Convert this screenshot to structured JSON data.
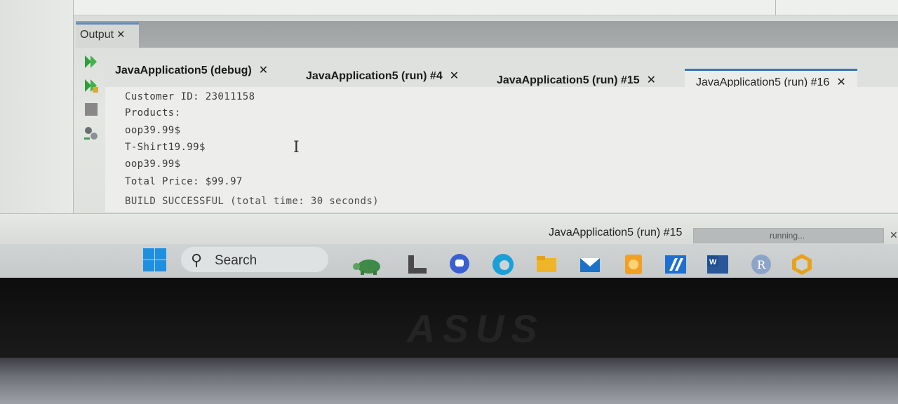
{
  "output_panel": {
    "title": "Output",
    "close_glyph": "✕"
  },
  "run_tabs": [
    {
      "label": "JavaApplication5 (debug)",
      "close": "✕"
    },
    {
      "label": "JavaApplication5 (run) #4",
      "close": "✕"
    },
    {
      "label": "JavaApplication5 (run) #15",
      "close": "✕"
    },
    {
      "label": "JavaApplication5 (run) #16",
      "close": "✕"
    }
  ],
  "console": {
    "lines": [
      "Customer ID: 23011158",
      "Products:",
      "oop39.99$",
      "T-Shirt19.99$",
      "oop39.99$",
      "Total Price: $99.97",
      "BUILD SUCCESSFUL (total time: 30 seconds)"
    ]
  },
  "status_bar": {
    "task_label": "JavaApplication5 (run) #15",
    "progress_text": "running...",
    "close_glyph": "✕"
  },
  "taskbar": {
    "search_label": "Search",
    "icons": [
      "windows-start-icon",
      "turtle-icon",
      "file-explorer-L-icon",
      "chat-icon",
      "edge-icon",
      "folder-icon",
      "mail-icon",
      "notes-icon",
      "ide-icon",
      "word-icon",
      "r-icon",
      "netbeans-icon"
    ]
  },
  "bezel": {
    "brand": "ASUS"
  },
  "colors": {
    "accent": "#3b74b4",
    "windows_blue": "#1f8fe0",
    "output_header": "#a5a8a9"
  }
}
